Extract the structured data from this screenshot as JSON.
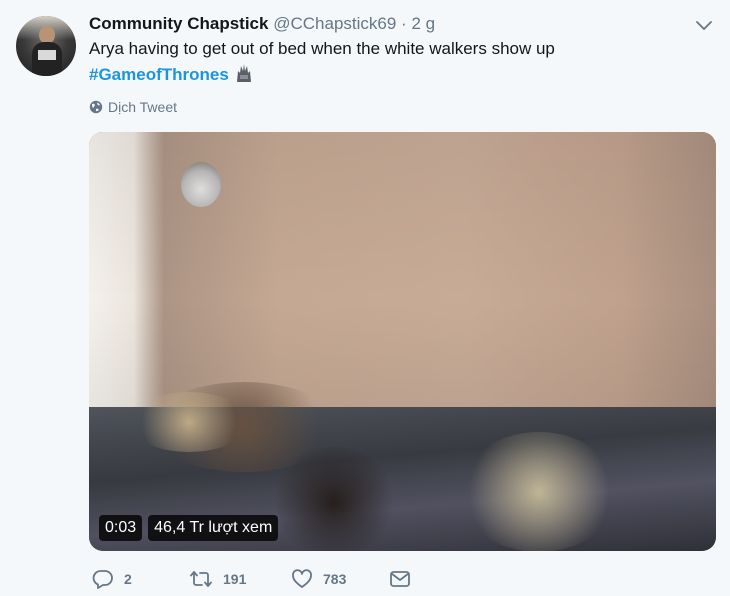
{
  "tweet": {
    "author_name": "Community Chapstick",
    "handle": "@CChapstick69",
    "separator": "·",
    "time": "2 g",
    "text": "Arya having to get out of bed when the white walkers show up",
    "hashtag": "#GameofThrones",
    "translate_label": "Dịch Tweet"
  },
  "video": {
    "duration": "0:03",
    "views": "46,4 Tr lượt xem"
  },
  "actions": {
    "reply_count": "2",
    "retweet_count": "191",
    "like_count": "783"
  },
  "icons": [
    "profile-avatar",
    "chevron-down-icon",
    "iron-throne-emoji-icon",
    "globe-icon",
    "reply-icon",
    "retweet-icon",
    "like-icon",
    "direct-message-icon"
  ],
  "colors": {
    "hashtag": "#1b95e0",
    "secondary_text": "#657786",
    "background": "#f5f8fa"
  }
}
